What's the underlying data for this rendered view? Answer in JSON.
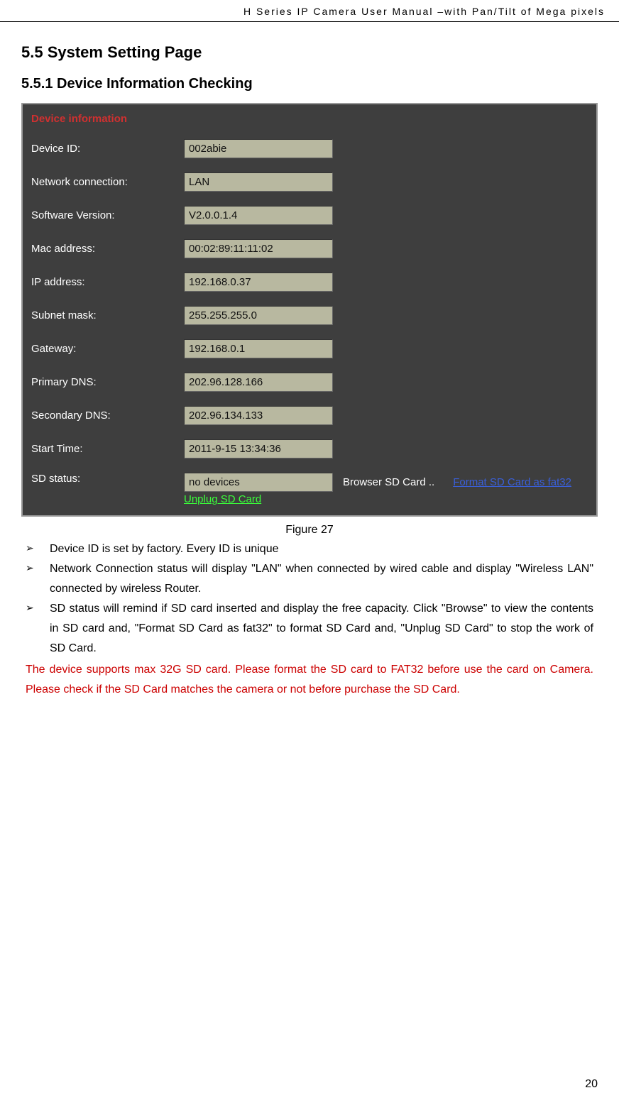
{
  "header": {
    "title": "H Series IP Camera User Manual –with Pan/Tilt of Mega pixels"
  },
  "section": {
    "heading": "5.5  System Setting Page",
    "subheading": "5.5.1   Device Information Checking"
  },
  "panel": {
    "title": "Device information",
    "rows": [
      {
        "label": "Device ID:",
        "value": "002abie"
      },
      {
        "label": "Network connection:",
        "value": "LAN"
      },
      {
        "label": "Software Version:",
        "value": "V2.0.0.1.4"
      },
      {
        "label": "Mac address:",
        "value": "00:02:89:11:11:02"
      },
      {
        "label": "IP address:",
        "value": "192.168.0.37"
      },
      {
        "label": "Subnet mask:",
        "value": "255.255.255.0"
      },
      {
        "label": "Gateway:",
        "value": "192.168.0.1"
      },
      {
        "label": "Primary DNS:",
        "value": "202.96.128.166"
      },
      {
        "label": "Secondary DNS:",
        "value": "202.96.134.133"
      },
      {
        "label": "Start Time:",
        "value": "2011-9-15 13:34:36"
      }
    ],
    "sd": {
      "label": "SD status:",
      "value": "no devices",
      "browser": "Browser SD Card ..",
      "format_link": "Format SD Card as fat32 ",
      "unplug": "Unplug SD Card"
    }
  },
  "figure_caption": "Figure 27",
  "bullets": [
    "Device ID is set by factory. Every ID is unique",
    "Network Connection status will display \"LAN\" when connected by wired cable and display \"Wireless LAN\" connected by wireless Router.",
    "SD status will remind if SD card inserted and display the free capacity. Click \"Browse\" to view the contents in SD card and, \"Format SD Card as fat32\" to format SD Card and, \"Unplug SD Card\" to stop the work of SD Card."
  ],
  "red_note": "The device supports max 32G SD card. Please format the SD card to FAT32 before use the card on Camera. Please check if the SD Card matches the camera or not before purchase the SD Card.",
  "page_number": "20"
}
